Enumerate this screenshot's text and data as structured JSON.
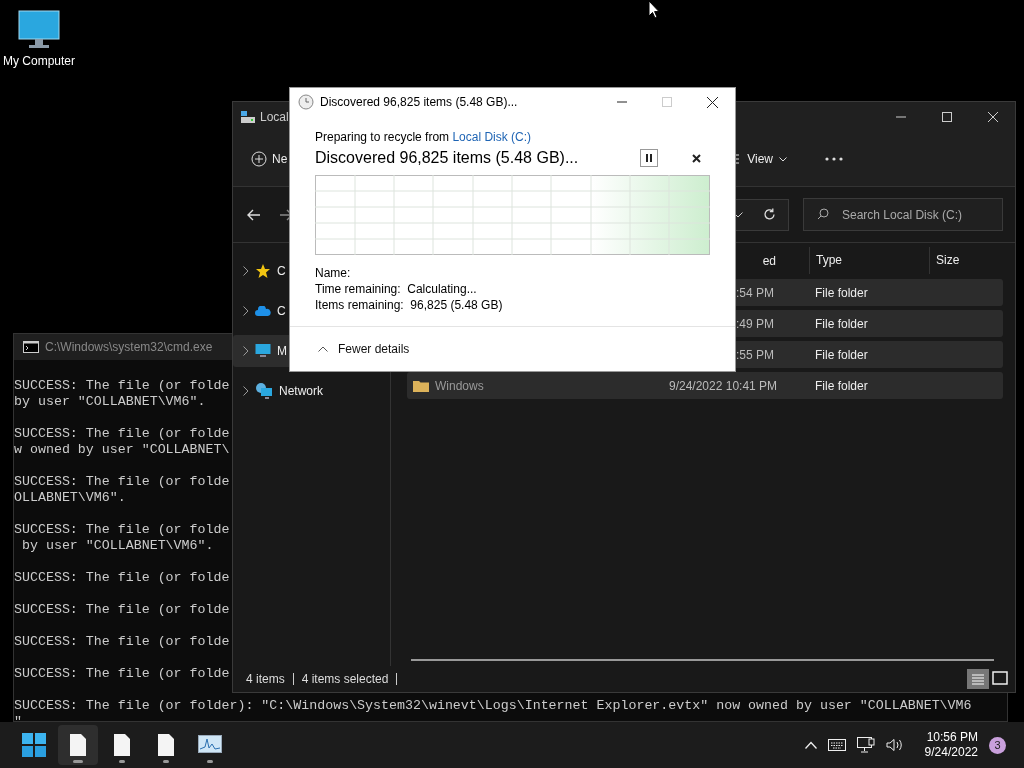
{
  "desktop_icons": [
    {
      "label": "My Computer"
    }
  ],
  "cmd": {
    "title": "C:\\Windows\\system32\\cmd.exe",
    "blocks": [
      [
        "SUCCESS: The file (or folde",
        "by user \"COLLABNET\\VM6\"."
      ],
      [
        "SUCCESS: The file (or folde",
        "w owned by user \"COLLABNET\\"
      ],
      [
        "SUCCESS: The file (or folde",
        "OLLABNET\\VM6\"."
      ],
      [
        "SUCCESS: The file (or folde",
        " by user \"COLLABNET\\VM6\"."
      ],
      [
        "SUCCESS: The file (or folde"
      ],
      [
        "SUCCESS: The file (or folde"
      ],
      [
        "SUCCESS: The file (or folde"
      ],
      [
        "SUCCESS: The file (or folde"
      ],
      [
        "SUCCESS: The file (or folder): \"C:\\Windows\\System32\\winevt\\Logs\\Internet Explorer.evtx\" now owned by user \"COLLABNET\\VM6",
        "\""
      ]
    ]
  },
  "explorer": {
    "title": "Local",
    "new_label": "Ne",
    "view_label": "View",
    "search": {
      "placeholder": "Search Local Disk (C:)"
    },
    "nav": [
      {
        "kind": "star",
        "label": "C",
        "selected": false
      },
      {
        "kind": "cloud",
        "label": "C",
        "selected": false
      },
      {
        "kind": "pc",
        "label": "M",
        "selected": true
      },
      {
        "kind": "network",
        "label": "Network",
        "selected": false
      }
    ],
    "columns": [
      "ed",
      "Type",
      "Size"
    ],
    "rows": [
      {
        "date": ":54 PM",
        "type": "File folder",
        "selected": true
      },
      {
        "date": ":49 PM",
        "type": "File folder",
        "selected": true
      },
      {
        "date": ":55 PM",
        "type": "File folder",
        "selected": true
      },
      {
        "name": "Windows",
        "date": "9/24/2022 10:41 PM",
        "type": "File folder",
        "selected": true
      }
    ],
    "status": {
      "count": "4 items",
      "selected_count": "4 items selected"
    }
  },
  "dialog": {
    "title": "Discovered 96,825 items (5.48 GB)...",
    "prefix": "Preparing to recycle from",
    "source": "Local Disk (C:)",
    "heading": "Discovered 96,825 items (5.48 GB)...",
    "details": [
      {
        "label": "Name:"
      },
      {
        "label": "Time remaining:",
        "value": "Calculating..."
      },
      {
        "label": "Items remaining:",
        "value": "96,825 (5.48 GB)"
      }
    ],
    "toggle": "Fewer details"
  },
  "taskbar": {
    "apps": [
      {
        "kind": "start",
        "selected": false
      },
      {
        "kind": "file",
        "selected": true
      },
      {
        "kind": "file",
        "selected": false
      },
      {
        "kind": "file",
        "selected": false
      },
      {
        "kind": "monitor",
        "selected": false
      }
    ],
    "time": "10:56 PM",
    "date": "9/24/2022",
    "badge": "3"
  }
}
